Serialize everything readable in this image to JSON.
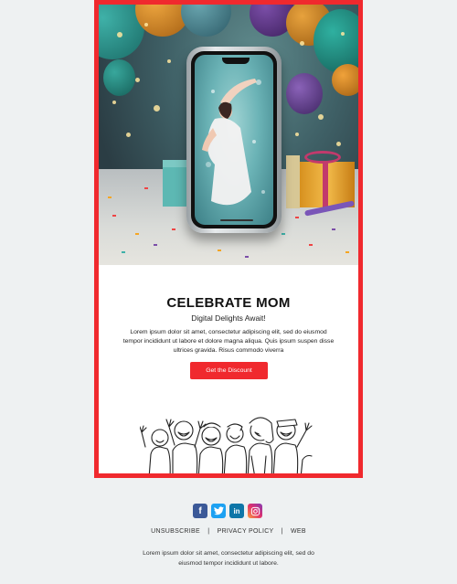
{
  "hero": {
    "image": "phone-with-celebration-photo"
  },
  "content": {
    "title": "CELEBRATE MOM",
    "subtitle": "Digital Delights Await!",
    "body": "Lorem ipsum dolor sit amet, consectetur adipiscing elit, sed do eiusmod tempor incididunt ut labore et dolore magna aliqua. Quis ipsum suspen disse ultrices gravida. Risus commodo viverra",
    "cta_label": "Get the Discount"
  },
  "social": {
    "icons": [
      "facebook-icon",
      "twitter-icon",
      "linkedin-icon",
      "instagram-icon"
    ],
    "facebook_glyph": "f",
    "linkedin_glyph": "in"
  },
  "footer": {
    "links": [
      "UNSUBSCRIBE",
      "PRIVACY POLICY",
      "WEB"
    ],
    "separator": "|",
    "text": "Lorem ipsum dolor sit amet, consectetur adipiscing elit, sed do eiusmod tempor incididunt ut labore."
  },
  "colors": {
    "accent": "#f0292e",
    "background": "#eef1f2",
    "card": "#ffffff"
  }
}
